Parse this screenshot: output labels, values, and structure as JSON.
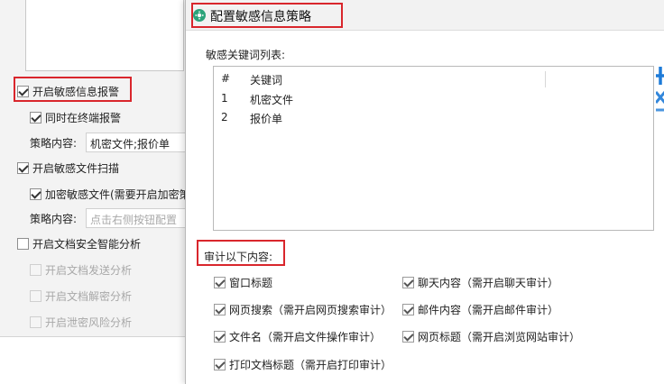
{
  "left_panel": {
    "alarm_enable": {
      "label": "开启敏感信息报警",
      "checked": true
    },
    "terminal_alarm": {
      "label": "同时在终端报警",
      "checked": true
    },
    "policy_label_1": "策略内容:",
    "policy_value_1": "机密文件;报价单",
    "file_scan": {
      "label": "开启敏感文件扫描",
      "checked": true
    },
    "encrypt_file": {
      "label": "加密敏感文件(需要开启加密策",
      "checked": true
    },
    "policy_label_2": "策略内容:",
    "policy_placeholder_2": "点击右侧按钮配置",
    "smart_analysis": {
      "label": "开启文档安全智能分析",
      "checked": false
    },
    "send_analysis": {
      "label": "开启文档发送分析",
      "checked": false,
      "disabled": true
    },
    "decrypt_analysis": {
      "label": "开启文档解密分析",
      "checked": false,
      "disabled": true
    },
    "leak_analysis": {
      "label": "开启泄密风险分析",
      "checked": false,
      "disabled": true
    }
  },
  "dialog": {
    "title": "配置敏感信息策略",
    "keyword_list_label": "敏感关键词列表:",
    "table": {
      "headers": [
        "#",
        "关键词"
      ],
      "rows": [
        {
          "index": "1",
          "keyword": "机密文件"
        },
        {
          "index": "2",
          "keyword": "报价单"
        }
      ]
    },
    "audit_label": "审计以下内容:",
    "audit_items": [
      {
        "label": "窗口标题",
        "checked": true
      },
      {
        "label": "聊天内容（需开启聊天审计）",
        "checked": true
      },
      {
        "label": "网页搜索（需开启网页搜索审计）",
        "checked": true
      },
      {
        "label": "邮件内容（需开启邮件审计）",
        "checked": true
      },
      {
        "label": "文件名（需开启文件操作审计）",
        "checked": true
      },
      {
        "label": "网页标题（需开启浏览网站审计）",
        "checked": true
      },
      {
        "label": "打印文档标题（需开启打印审计）",
        "checked": true
      }
    ]
  },
  "colors": {
    "highlight_box": "#d9262c",
    "title_icon": "#2ba37a",
    "add_icon": "#1e7bd8"
  },
  "icons": {
    "title": "policy-config-icon",
    "add": "add-keyword-icon"
  }
}
